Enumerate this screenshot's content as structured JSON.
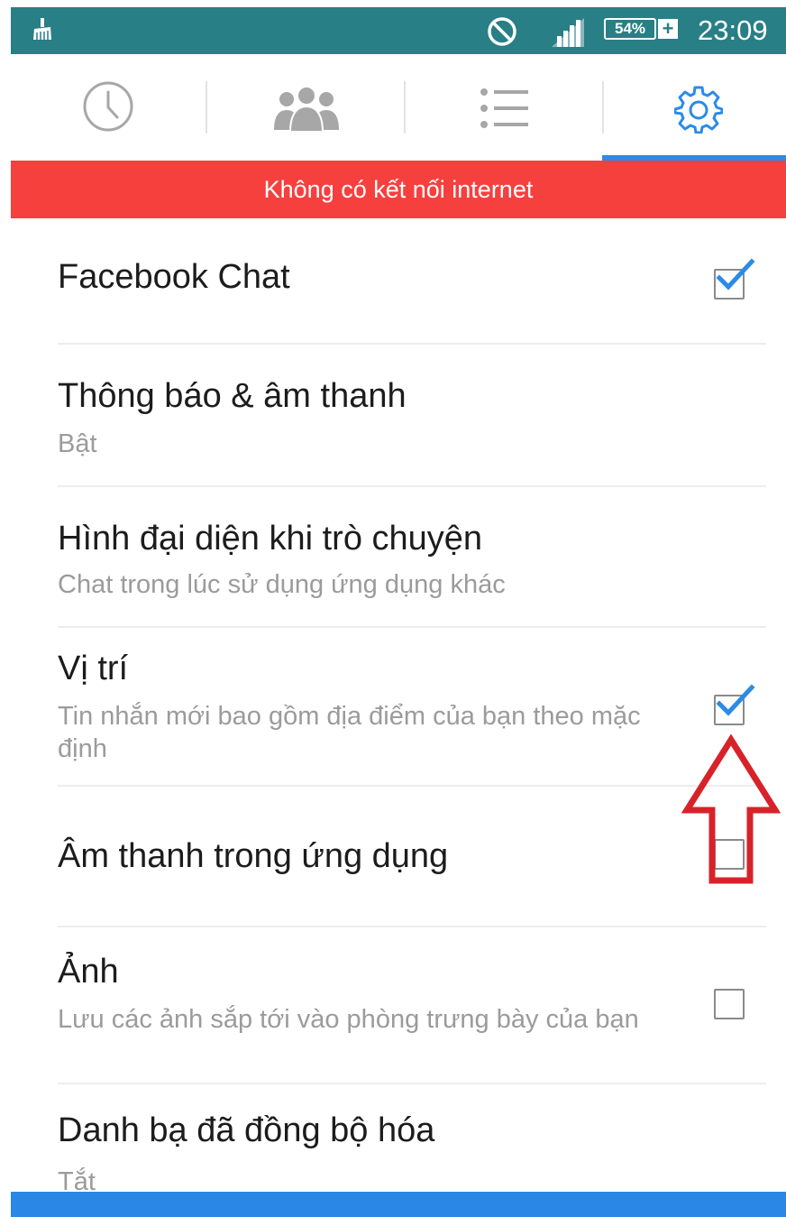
{
  "status_bar": {
    "battery": "54%",
    "battery_plus": "+",
    "time": "23:09",
    "icons": [
      "cleaner-icon",
      "do-not-disturb-icon",
      "signal-icon",
      "battery-icon"
    ]
  },
  "tabs": [
    {
      "icon": "clock-icon",
      "active": false
    },
    {
      "icon": "people-icon",
      "active": false
    },
    {
      "icon": "list-icon",
      "active": false
    },
    {
      "icon": "gear-icon",
      "active": true
    }
  ],
  "banner": {
    "text": "Không có kết nối internet"
  },
  "settings": [
    {
      "title": "Facebook Chat",
      "subtitle": "",
      "checked": true
    },
    {
      "title": "Thông báo & âm thanh",
      "subtitle": "Bật"
    },
    {
      "title": "Hình đại diện khi trò chuyện",
      "subtitle": "Chat trong lúc sử dụng ứng dụng khác"
    },
    {
      "title": "Vị trí",
      "subtitle": "Tin nhắn mới bao gồm địa điểm của bạn theo mặc định",
      "checked": true
    },
    {
      "title": "Âm thanh trong ứng dụng",
      "subtitle": "",
      "checked": false
    },
    {
      "title": "Ảnh",
      "subtitle": "Lưu các ảnh sắp tới vào phòng trưng bày của bạn",
      "checked": false
    },
    {
      "title": "Danh bạ đã đồng bộ hóa",
      "subtitle": "Tắt"
    }
  ],
  "colors": {
    "status_bar": "#287f85",
    "banner": "#f5403e",
    "accent": "#2b8be6",
    "annotation_arrow": "#d8222a"
  }
}
